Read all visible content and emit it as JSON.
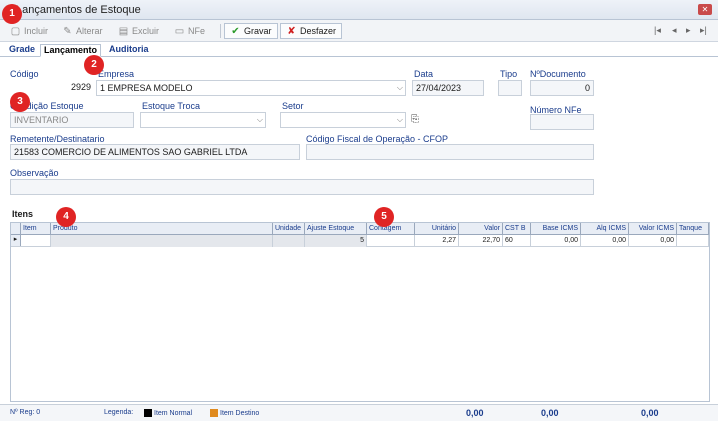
{
  "window": {
    "title": "Lançamentos de Estoque"
  },
  "toolbar": {
    "incluir": "Incluir",
    "alterar": "Alterar",
    "excluir": "Excluir",
    "nfe": "NFe",
    "gravar": "Gravar",
    "desfazer": "Desfazer",
    "nav_first": "|◂",
    "nav_prev": "◂",
    "nav_next": "▸",
    "nav_last": "▸|"
  },
  "tabs": [
    "Grade",
    "Lançamento",
    "Auditoria"
  ],
  "form": {
    "codigo_label": "Código",
    "codigo_value": "2929",
    "empresa_label": "Empresa",
    "empresa_value": "1 EMPRESA MODELO",
    "data_label": "Data",
    "data_value": "27/04/2023",
    "tipo_label": "Tipo",
    "ndoc_label": "NºDocumento",
    "ndoc_value": "0",
    "condicao_label": "Condição Estoque",
    "condicao_value": "INVENTARIO",
    "estoque_troca_label": "Estoque Troca",
    "setor_label": "Setor",
    "numero_nfe_label": "Número NFe",
    "remetente_label": "Remetente/Destinatario",
    "remetente_value": "21583 COMERCIO DE ALIMENTOS SAO GABRIEL LTDA",
    "cfop_label": "Código Fiscal de Operação - CFOP",
    "observacao_label": "Observação"
  },
  "items": {
    "label": "Itens",
    "columns": [
      "Item",
      "Produto",
      "Unidade",
      "Ajuste Estoque",
      "Contagem",
      "Unitário",
      "Valor",
      "CST B",
      "Base ICMS",
      "Alq ICMS",
      "Valor ICMS",
      "Tanque"
    ],
    "row": {
      "item": "",
      "produto": "",
      "unidade": "",
      "ajuste": "5",
      "contagem": "",
      "unitario": "2,27",
      "valor": "22,70",
      "cst": "60",
      "base_icms": "0,00",
      "alq_icms": "0,00",
      "valor_icms": "0,00",
      "tanque": ""
    }
  },
  "status": {
    "nreg": "Nº Reg: 0",
    "legenda": "Legenda:",
    "normal": "Item Normal",
    "destino": "Item Destino",
    "total1": "0,00",
    "total2": "0,00",
    "total3": "0,00",
    "normal_color": "#000000",
    "destino_color": "#e08a1e"
  },
  "badges": [
    "1",
    "2",
    "3",
    "4",
    "5"
  ]
}
